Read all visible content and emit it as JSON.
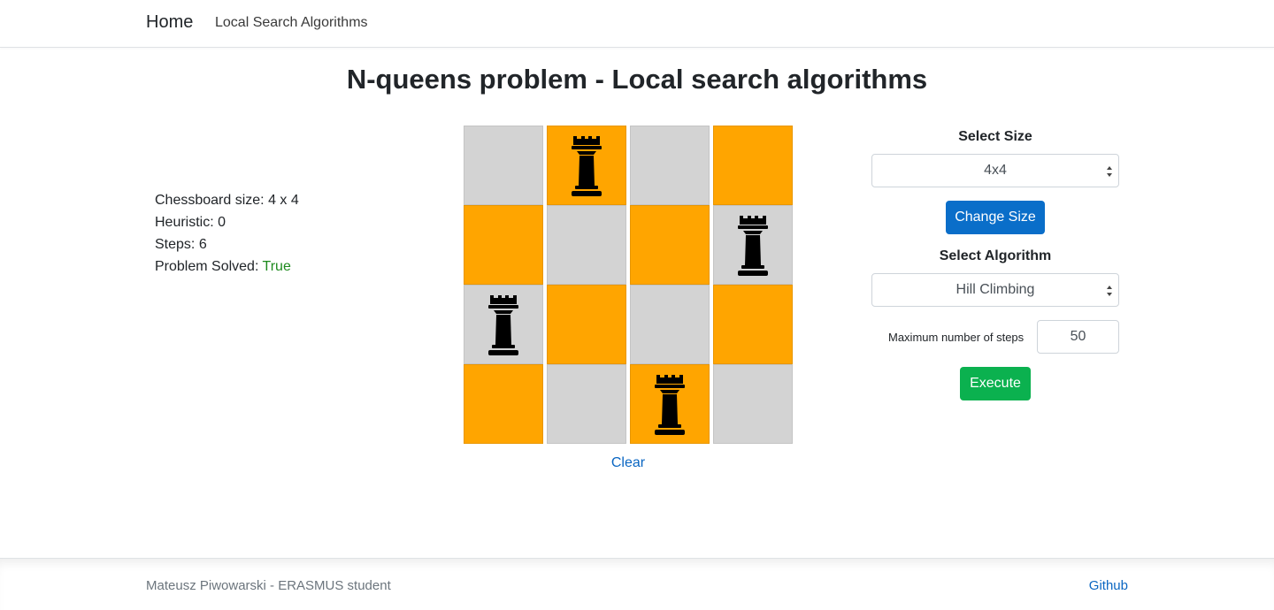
{
  "nav": {
    "brand": "Home",
    "link": "Local Search Algorithms"
  },
  "title": "N-queens problem - Local search algorithms",
  "stats": {
    "size_label": "Chessboard size: ",
    "size_value": "4 x 4",
    "heuristic_label": "Heuristic: ",
    "heuristic_value": "0",
    "steps_label": "Steps: ",
    "steps_value": "6",
    "solved_label": "Problem Solved: ",
    "solved_value": "True"
  },
  "board": {
    "size": 4,
    "light_color": "#d3d3d3",
    "dark_color": "#ffa500",
    "queen_icon": "chess-queen-icon",
    "queens_row_by_column": [
      2,
      0,
      3,
      1
    ]
  },
  "clear_label": "Clear",
  "controls": {
    "size_label": "Select Size",
    "size_selected": "4x4",
    "change_size_label": "Change Size",
    "algorithm_label": "Select Algorithm",
    "algorithm_selected": "Hill Climbing",
    "max_steps_label": "Maximum number of steps",
    "max_steps_value": "50",
    "execute_label": "Execute"
  },
  "colors": {
    "primary": "#0a6ec9",
    "success": "#0bb14f",
    "solved": "#1e8a1e",
    "link": "#0a66c2"
  },
  "footer": {
    "author": "Mateusz Piwowarski - ERASMUS student",
    "github": "Github"
  }
}
